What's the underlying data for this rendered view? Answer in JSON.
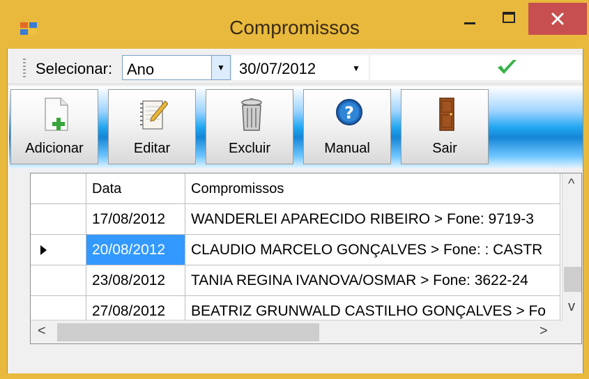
{
  "window": {
    "title": "Compromissos",
    "accent_color": "#e8b93c",
    "close_color": "#c74f4f",
    "icons": {
      "app": "app-icon",
      "minimize": "minimize-icon",
      "maximize": "maximize-icon",
      "close": "close-icon"
    }
  },
  "filter": {
    "label": "Selecionar:",
    "period_value": "Ano",
    "date_value": "30/07/2012",
    "confirm_icon": "checkmark-icon"
  },
  "toolbar": {
    "buttons": [
      {
        "label": "Adicionar",
        "icon": "add-document-icon"
      },
      {
        "label": "Editar",
        "icon": "notepad-pencil-icon"
      },
      {
        "label": "Excluir",
        "icon": "trash-can-icon"
      },
      {
        "label": "Manual",
        "icon": "help-icon"
      },
      {
        "label": "Sair",
        "icon": "door-icon"
      }
    ]
  },
  "grid": {
    "columns": [
      "Data",
      "Compromissos"
    ],
    "rows": [
      {
        "date": "17/08/2012",
        "text": "WANDERLEI APARECIDO RIBEIRO > Fone: 9719-3",
        "selected": false
      },
      {
        "date": "20/08/2012",
        "text": "CLAUDIO MARCELO GONÇALVES > Fone: : CASTR",
        "selected": true
      },
      {
        "date": "23/08/2012",
        "text": "TANIA REGINA IVANOVA/OSMAR > Fone: 3622-24",
        "selected": false
      },
      {
        "date": "27/08/2012",
        "text": "BEATRIZ GRUNWALD CASTILHO GONÇALVES > Fo",
        "selected": false
      }
    ],
    "selection_color": "#3399ff"
  }
}
